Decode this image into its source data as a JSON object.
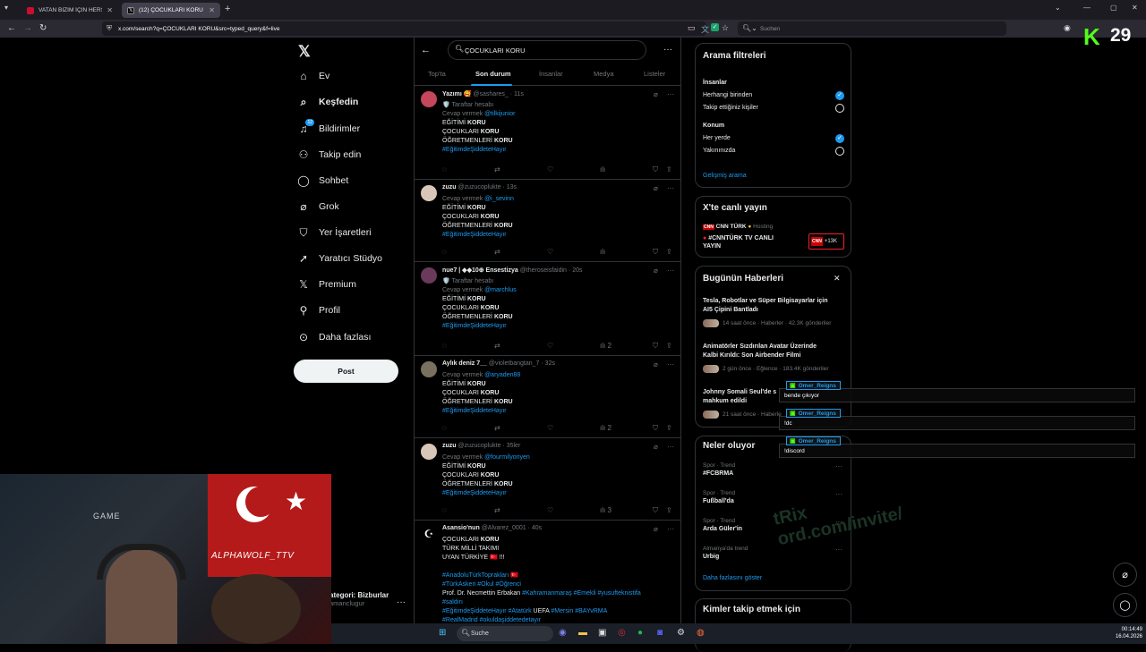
{
  "browser": {
    "tabs": [
      {
        "title": "VATAN BİZİM İÇİN HERŞEYDEN",
        "active": false
      },
      {
        "title": "(12) ÇOCUKLARI KORU - Arama",
        "active": true
      }
    ],
    "url": "x.com/search?q=ÇOCUKLARI KORU&src=typed_query&f=live",
    "search_placeholder": "Suchen"
  },
  "nav": {
    "items": [
      {
        "label": "Ev",
        "icon": "home-icon"
      },
      {
        "label": "Keşfedin",
        "icon": "search-icon",
        "bold": true
      },
      {
        "label": "Bildirimler",
        "icon": "bell-icon",
        "badge": "12"
      },
      {
        "label": "Takip edin",
        "icon": "follow-icon"
      },
      {
        "label": "Sohbet",
        "icon": "chat-icon"
      },
      {
        "label": "Grok",
        "icon": "grok-icon"
      },
      {
        "label": "Yer İşaretleri",
        "icon": "bookmark-icon"
      },
      {
        "label": "Yaratıcı Stüdyo",
        "icon": "rocket-icon"
      },
      {
        "label": "Premium",
        "icon": "x-icon"
      },
      {
        "label": "Profil",
        "icon": "profile-icon"
      },
      {
        "label": "Daha fazlası",
        "icon": "more-icon"
      }
    ],
    "post_label": "Post",
    "account_name": "ategori: Bizburlar",
    "account_handle": "amanclugur"
  },
  "search": {
    "query": "ÇOCUKLARI KORU",
    "tabs": [
      "Top'ta",
      "Son durum",
      "İnsanlar",
      "Medya",
      "Listeler"
    ]
  },
  "tweets": [
    {
      "name": "Yazımı 🥰",
      "handle": "@sashares_",
      "time": "11s",
      "lines": [
        {
          "t": "🛡️ Taraftar hesabı",
          "cls": "gray"
        },
        {
          "t": "Cevap vermek ",
          "blue": "@tilkijunior",
          "cls": "gray"
        },
        {
          "t": "EĞİTİMİ ",
          "b": "KORU"
        },
        {
          "t": "ÇOCUKLARI ",
          "b": "KORU"
        },
        {
          "t": "ÖĞRETMENLERİ ",
          "b": "KORU"
        },
        {
          "t": "",
          "blue": "#EğitimdeŞiddeteHayır"
        }
      ],
      "stats": {
        "views": ""
      }
    },
    {
      "name": "zuzu",
      "handle": "@zuzucoplukte",
      "time": "13s",
      "lines": [
        {
          "t": "Cevap vermek ",
          "blue": "@i_sevinn",
          "cls": "gray"
        },
        {
          "t": "EĞİTİMİ ",
          "b": "KORU"
        },
        {
          "t": "ÇOCUKLARI ",
          "b": "KORU"
        },
        {
          "t": "ÖĞRETMENLERİ ",
          "b": "KORU"
        },
        {
          "t": " ",
          "blue": "#EğitimdeŞiddeteHayır"
        }
      ],
      "stats": {
        "views": ""
      }
    },
    {
      "name": "nue7 | ◆◆10⊕ Ensestizya",
      "handle": "@theroseisfaidin",
      "time": "20s",
      "lines": [
        {
          "t": "🛡️ Taraftar hesabı",
          "cls": "gray"
        },
        {
          "t": "Cevap vermek ",
          "blue": "@marchlus",
          "cls": "gray"
        },
        {
          "t": "EĞİTİMİ ",
          "b": "KORU"
        },
        {
          "t": "ÇOCUKLARI ",
          "b": "KORU"
        },
        {
          "t": "ÖĞRETMENLERİ ",
          "b": "KORU"
        },
        {
          "t": "",
          "blue": "#EğitimdeŞiddeteHayır"
        }
      ],
      "stats": {
        "views": "2"
      }
    },
    {
      "name": "Aylık deniz 7__",
      "handle": "@violetbangtan_7",
      "time": "32s",
      "lines": [
        {
          "t": "Cevap vermek ",
          "blue": "@aryaden88",
          "cls": "gray"
        },
        {
          "t": "EĞİTİMİ ",
          "b": "KORU"
        },
        {
          "t": "ÇOCUKLARI ",
          "b": "KORU"
        },
        {
          "t": "ÖĞRETMENLERİ ",
          "b": "KORU"
        },
        {
          "t": "",
          "blue": "#EğitimdeŞiddeteHayır"
        }
      ],
      "stats": {
        "views": "2"
      }
    },
    {
      "name": "zuzu",
      "handle": "@zuzucoplukte",
      "time": "35ler",
      "lines": [
        {
          "t": "Cevap vermek ",
          "blue": "@fourmilyonyen",
          "cls": "gray"
        },
        {
          "t": "EĞİTİMİ ",
          "b": "KORU"
        },
        {
          "t": "ÇOCUKLARI ",
          "b": "KORU"
        },
        {
          "t": "ÖĞRETMENLERİ ",
          "b": "KORU"
        },
        {
          "t": " ",
          "blue": "#EğitimdeŞiddeteHayır"
        }
      ],
      "stats": {
        "views": "3"
      }
    },
    {
      "name": "Asansio'nun",
      "handle": "@Alvarez_0001",
      "time": "40s",
      "lines": [
        {
          "t": "ÇOCUKLARI ",
          "b": "KORU"
        },
        {
          "t": "TÜRK MİLLİ TAKIMI"
        },
        {
          "t": "UYAN TÜRKİYE 🇹🇷 !!!"
        },
        {
          "t": ""
        },
        {
          "t": "",
          "blue": "#AnadoluTürkToprakları 🇹🇷"
        },
        {
          "t": " ",
          "blue": "#TürkAskeri  #Okul #Öğrenci"
        },
        {
          "t": "Prof. Dr. Necmettin Erbakan ",
          "blue": "#Kahramanmaraş #Emekli #yusufteknistifa"
        },
        {
          "t": "",
          "blue": "#saldırı"
        },
        {
          "t": " ",
          "blue": "#EğitimdeŞiddeteHayır #Atatürk",
          "tail": " UEFA ",
          "blue2": "#Mersin #BAYvRMA"
        },
        {
          "t": " ",
          "blue": "#RealMadrid #okuldaşiddetedetayır"
        }
      ],
      "stats": {
        "views": ""
      }
    }
  ],
  "filters": {
    "title": "Arama filtreleri",
    "people_label": "İnsanlar",
    "people_opts": [
      "Herhangi birinden",
      "Takip ettiğiniz kişiler"
    ],
    "location_label": "Konum",
    "location_opts": [
      "Her yerde",
      "Yakınınızda"
    ],
    "advanced": "Gelişmiş arama"
  },
  "live": {
    "title": "X'te canlı yayın",
    "host": "CNN TÜRK",
    "host_role": "Hosting",
    "stream_line1": "#CNNTÜRK TV CANLI",
    "stream_line2": "YAYIN",
    "listeners": "+13K",
    "badge": "CNN"
  },
  "news": {
    "title": "Bugünün Haberleri",
    "items": [
      {
        "l1": "Tesla, Robotlar ve Süper Bilgisayarlar için",
        "l2": "AI5 Çipini Bantladı",
        "meta": "14 saat önce · Haberler · 42.3K gönderiler"
      },
      {
        "l1": "Animatörler Sızdırılan Avatar Üzerinde",
        "l2": "Kalbi Kırıldı: Son Airbender Filmi",
        "meta": "2 gün önce · Eğlence · 183.4K gönderiler"
      },
      {
        "l1": "Johnny Somali Seul'de s",
        "l2": "mahkum edildi",
        "meta": "21 saat önce · Haberle"
      }
    ]
  },
  "trends": {
    "title": "Neler oluyor",
    "items": [
      {
        "cat": "Spor · Trend",
        "name": "#FCBRMA"
      },
      {
        "cat": "Spor · Trend",
        "name": "Fußball'da"
      },
      {
        "cat": "Spor · Trend",
        "name": "Arda Güler'in"
      },
      {
        "cat": "Almanya'da trend",
        "name": "Urbig"
      }
    ],
    "more": "Daha fazlasını göster"
  },
  "follow": {
    "title": "Kimler takip etmek için"
  },
  "chat": [
    {
      "user": "Omer_Reigns",
      "msg": "bende çıkıyor"
    },
    {
      "user": "Omer_Reigns",
      "msg": "!dc"
    },
    {
      "user": "Omer_Reigns",
      "msg": "!discord"
    }
  ],
  "kick": {
    "logo": "K",
    "count": "29"
  },
  "webcam": {
    "game_text": "GAME",
    "wolf_text": "ALPHAWOLF_TTV"
  },
  "watermark": "tRix\nord.com/invite/",
  "taskbar": {
    "search": "Suche",
    "time": "00:14:49",
    "date": "16.04.2026"
  },
  "colors": {
    "accent": "#1d9bf0",
    "kick": "#53fc18",
    "bg": "#000000"
  }
}
